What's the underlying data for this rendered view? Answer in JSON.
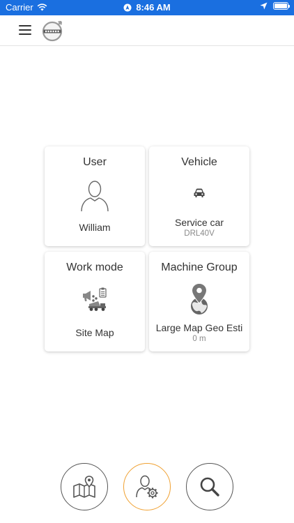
{
  "status_bar": {
    "carrier": "Carrier",
    "time": "8:46 AM"
  },
  "tiles": {
    "user": {
      "title": "User",
      "value": "William"
    },
    "vehicle": {
      "title": "Vehicle",
      "value": "Service car",
      "sub": "DRL40V"
    },
    "work_mode": {
      "title": "Work mode",
      "value": "Site Map"
    },
    "machine_group": {
      "title": "Machine Group",
      "value": "Large Map Geo Esti",
      "sub": "0 m"
    }
  },
  "bottom_nav": {
    "active": "user-settings",
    "active_color": "#f0a030"
  },
  "colors": {
    "status_bar": "#1a6fe0",
    "text": "#333333",
    "muted": "#8a8a8a",
    "icon": "#555555"
  }
}
